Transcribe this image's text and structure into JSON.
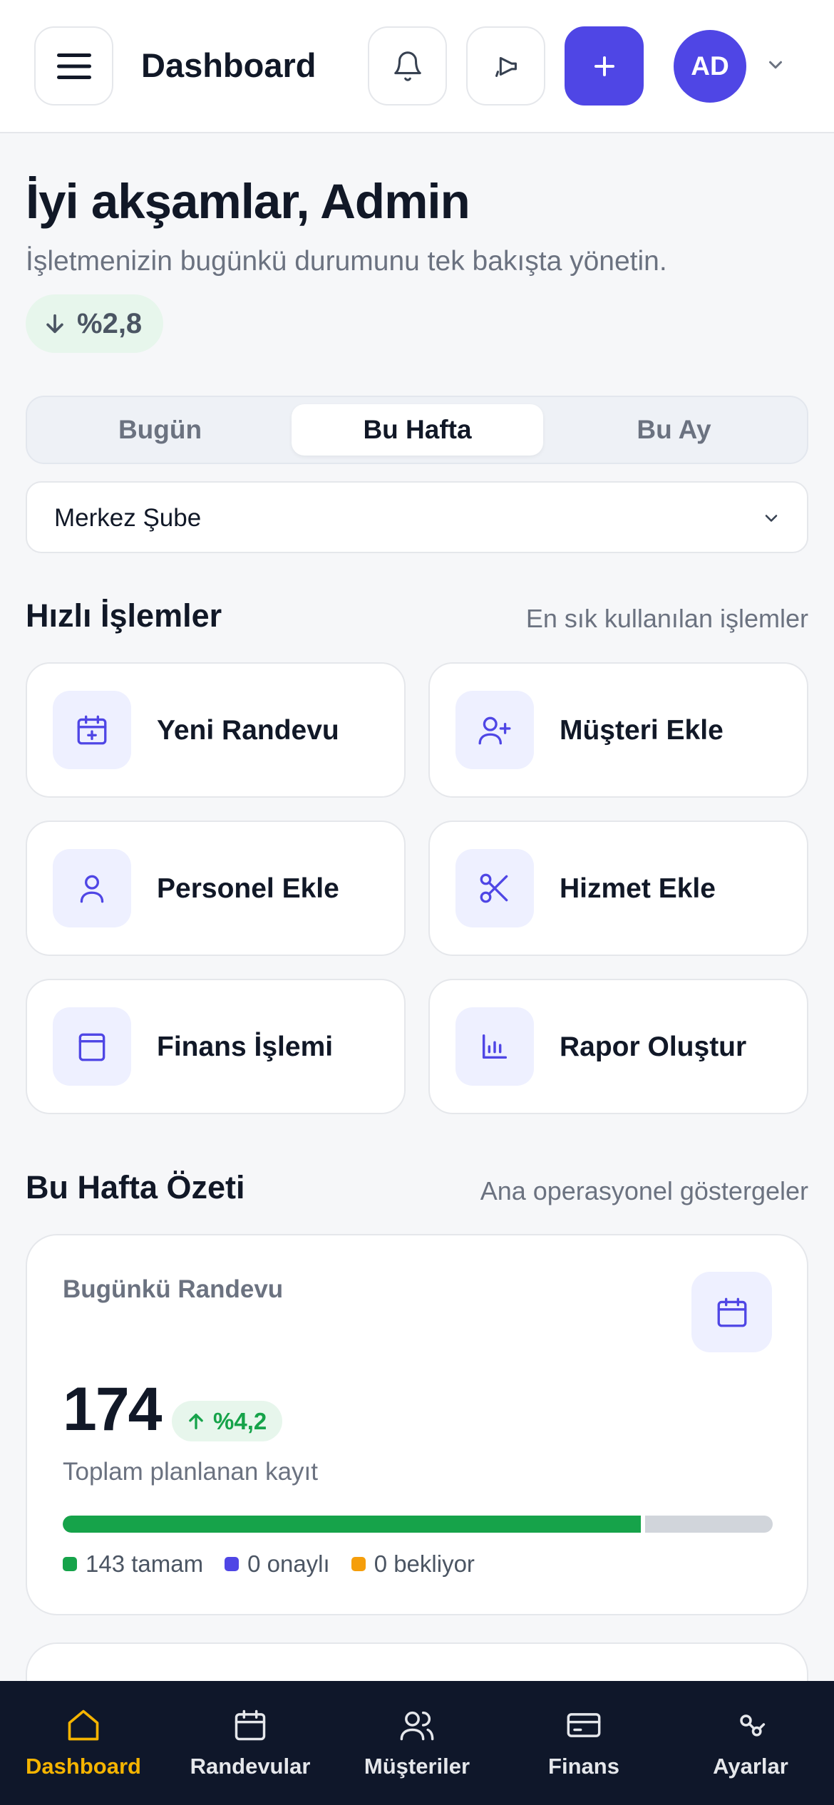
{
  "header": {
    "title": "Dashboard",
    "menu_icon": "hamburger-icon",
    "notifications_icon": "bell-icon",
    "announcements_icon": "megaphone-icon",
    "add_icon": "plus-icon",
    "avatar_initials": "AD",
    "avatar_caret_icon": "chevron-down-icon"
  },
  "greeting": {
    "title": "İyi akşamlar, Admin",
    "subtitle": "İşletmenizin bugünkü durumunu tek bakışta yönetin.",
    "trend": "%2,8",
    "trend_direction": "down"
  },
  "period_tabs": [
    {
      "label": "Bugün",
      "active": false
    },
    {
      "label": "Bu Hafta",
      "active": true
    },
    {
      "label": "Bu Ay",
      "active": false
    }
  ],
  "branch_select": {
    "value": "Merkez Şube"
  },
  "quick_actions": {
    "title": "Hızlı İşlemler",
    "hint": "En sık kullanılan işlemler",
    "items": [
      {
        "label": "Yeni Randevu",
        "icon": "calendar-plus-icon"
      },
      {
        "label": "Müşteri Ekle",
        "icon": "user-plus-icon"
      },
      {
        "label": "Personel Ekle",
        "icon": "user-icon"
      },
      {
        "label": "Hizmet Ekle",
        "icon": "scissors-icon"
      },
      {
        "label": "Finans İşlemi",
        "icon": "wallet-icon"
      },
      {
        "label": "Rapor Oluştur",
        "icon": "bar-chart-icon"
      }
    ]
  },
  "summary": {
    "title": "Bu Hafta Özeti",
    "hint": "Ana operasyonel göstergeler",
    "card": {
      "label": "Bugünkü Randevu",
      "icon": "calendar-icon",
      "value": "174",
      "trend": "%4,2",
      "trend_direction": "up",
      "description": "Toplam planlanan kayıt",
      "progress_fraction": 0.82,
      "legend": [
        {
          "label": "143 tamam",
          "color": "#16a34a"
        },
        {
          "label": "0 onaylı",
          "color": "#4f46e5"
        },
        {
          "label": "0 bekliyor",
          "color": "#f59e0b"
        }
      ]
    }
  },
  "bottom_nav": [
    {
      "label": "Dashboard",
      "icon": "home-icon",
      "active": true
    },
    {
      "label": "Randevular",
      "icon": "calendar-icon",
      "active": false
    },
    {
      "label": "Müşteriler",
      "icon": "users-icon",
      "active": false
    },
    {
      "label": "Finans",
      "icon": "credit-card-icon",
      "active": false
    },
    {
      "label": "Ayarlar",
      "icon": "settings-icon",
      "active": false
    }
  ],
  "colors": {
    "accent": "#4f46e5",
    "success": "#16a34a",
    "warning": "#f59e0b",
    "nav_background": "#0f172a",
    "nav_active": "#f5b400"
  }
}
